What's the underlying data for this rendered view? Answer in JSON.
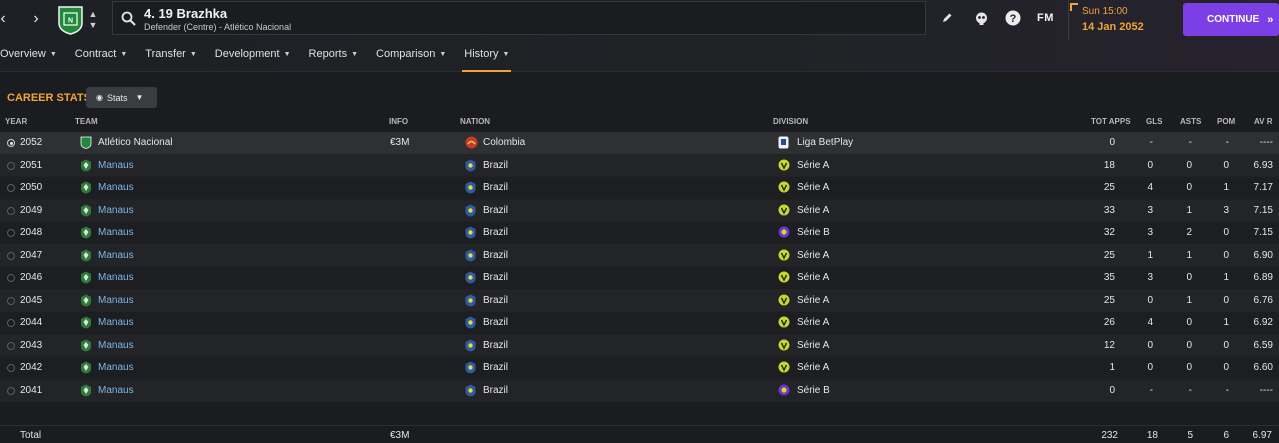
{
  "header": {
    "player_title": "4. 19 Brazhka",
    "player_subtitle": "Defender (Centre) - Atlético Nacional",
    "fm_label": "FM",
    "time": "Sun 15:00",
    "date": "14 Jan 2052",
    "continue_label": "CONTINUE"
  },
  "tabs": [
    {
      "label": "Overview"
    },
    {
      "label": "Contract"
    },
    {
      "label": "Transfer"
    },
    {
      "label": "Development"
    },
    {
      "label": "Reports"
    },
    {
      "label": "Comparison"
    },
    {
      "label": "History"
    }
  ],
  "section": {
    "title": "CAREER STATS",
    "view_button": "Stats"
  },
  "columns": {
    "year": "YEAR",
    "team": "TEAM",
    "info": "INFO",
    "nation": "NATION",
    "division": "DIVISION",
    "apps": "TOT APPS",
    "gls": "GLS",
    "asts": "ASTS",
    "pom": "POM",
    "avr": "AV R"
  },
  "rows": [
    {
      "year": "2052",
      "team": "Atlético Nacional",
      "info": "€3M",
      "nation": "Colombia",
      "division": "Liga BetPlay",
      "apps": "0",
      "gls": "-",
      "asts": "-",
      "pom": "-",
      "avr": "----"
    },
    {
      "year": "2051",
      "team": "Manaus",
      "info": "",
      "nation": "Brazil",
      "division": "Série A",
      "apps": "18",
      "gls": "0",
      "asts": "0",
      "pom": "0",
      "avr": "6.93"
    },
    {
      "year": "2050",
      "team": "Manaus",
      "info": "",
      "nation": "Brazil",
      "division": "Série A",
      "apps": "25",
      "gls": "4",
      "asts": "0",
      "pom": "1",
      "avr": "7.17"
    },
    {
      "year": "2049",
      "team": "Manaus",
      "info": "",
      "nation": "Brazil",
      "division": "Série A",
      "apps": "33",
      "gls": "3",
      "asts": "1",
      "pom": "3",
      "avr": "7.15"
    },
    {
      "year": "2048",
      "team": "Manaus",
      "info": "",
      "nation": "Brazil",
      "division": "Série B",
      "apps": "32",
      "gls": "3",
      "asts": "2",
      "pom": "0",
      "avr": "7.15"
    },
    {
      "year": "2047",
      "team": "Manaus",
      "info": "",
      "nation": "Brazil",
      "division": "Série A",
      "apps": "25",
      "gls": "1",
      "asts": "1",
      "pom": "0",
      "avr": "6.90"
    },
    {
      "year": "2046",
      "team": "Manaus",
      "info": "",
      "nation": "Brazil",
      "division": "Série A",
      "apps": "35",
      "gls": "3",
      "asts": "0",
      "pom": "1",
      "avr": "6.89"
    },
    {
      "year": "2045",
      "team": "Manaus",
      "info": "",
      "nation": "Brazil",
      "division": "Série A",
      "apps": "25",
      "gls": "0",
      "asts": "1",
      "pom": "0",
      "avr": "6.76"
    },
    {
      "year": "2044",
      "team": "Manaus",
      "info": "",
      "nation": "Brazil",
      "division": "Série A",
      "apps": "26",
      "gls": "4",
      "asts": "0",
      "pom": "1",
      "avr": "6.92"
    },
    {
      "year": "2043",
      "team": "Manaus",
      "info": "",
      "nation": "Brazil",
      "division": "Série A",
      "apps": "12",
      "gls": "0",
      "asts": "0",
      "pom": "0",
      "avr": "6.59"
    },
    {
      "year": "2042",
      "team": "Manaus",
      "info": "",
      "nation": "Brazil",
      "division": "Série A",
      "apps": "1",
      "gls": "0",
      "asts": "0",
      "pom": "0",
      "avr": "6.60"
    },
    {
      "year": "2041",
      "team": "Manaus",
      "info": "",
      "nation": "Brazil",
      "division": "Série B",
      "apps": "0",
      "gls": "-",
      "asts": "-",
      "pom": "-",
      "avr": "----"
    }
  ],
  "totals": {
    "label": "Total",
    "info": "€3M",
    "apps": "232",
    "gls": "18",
    "asts": "5",
    "pom": "6",
    "avr": "6.97"
  },
  "colors": {
    "accent": "#f0a43a",
    "continue_bg": "#7c3fe6",
    "link": "#7ab8e8"
  }
}
